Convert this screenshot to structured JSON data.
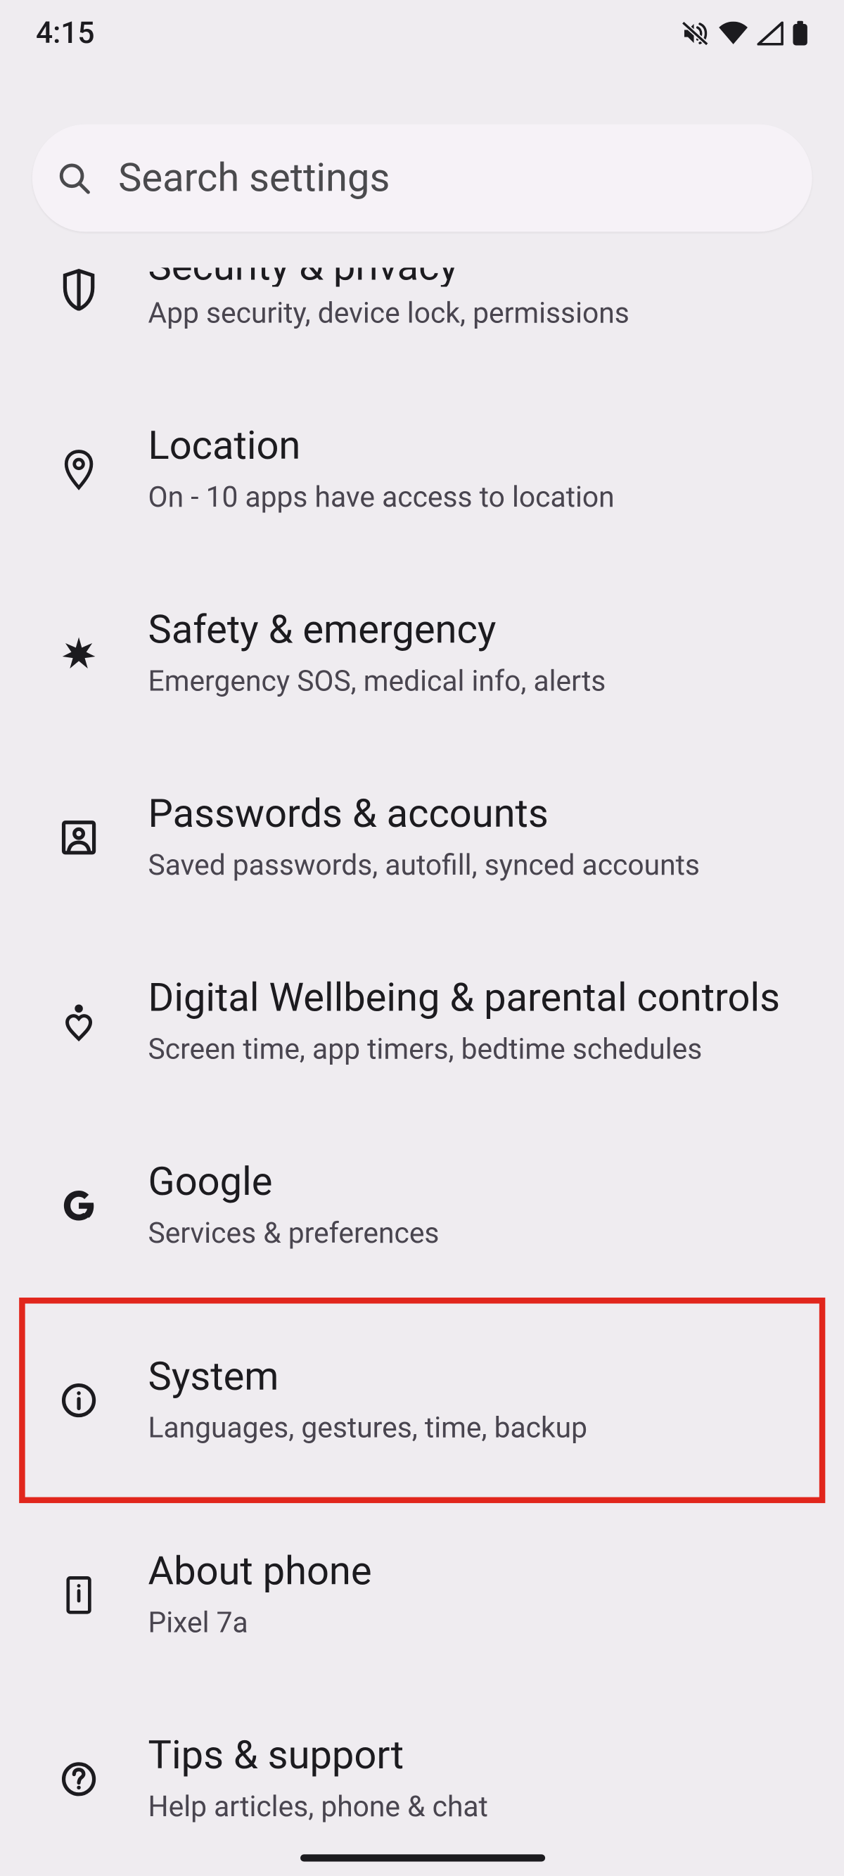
{
  "status": {
    "time": "4:15"
  },
  "search": {
    "placeholder": "Search settings"
  },
  "items": {
    "security": {
      "title": "Security & privacy",
      "sub": "App security, device lock, permissions"
    },
    "location": {
      "title": "Location",
      "sub": "On - 10 apps have access to location"
    },
    "safety": {
      "title": "Safety & emergency",
      "sub": "Emergency SOS, medical info, alerts"
    },
    "passwords": {
      "title": "Passwords & accounts",
      "sub": "Saved passwords, autofill, synced accounts"
    },
    "digital": {
      "title": "Digital Wellbeing & parental controls",
      "sub": "Screen time, app timers, bedtime schedules"
    },
    "google": {
      "title": "Google",
      "sub": "Services & preferences"
    },
    "system": {
      "title": "System",
      "sub": "Languages, gestures, time, backup"
    },
    "about": {
      "title": "About phone",
      "sub": "Pixel 7a"
    },
    "tips": {
      "title": "Tips & support",
      "sub": "Help articles, phone & chat"
    }
  },
  "highlight": "system"
}
